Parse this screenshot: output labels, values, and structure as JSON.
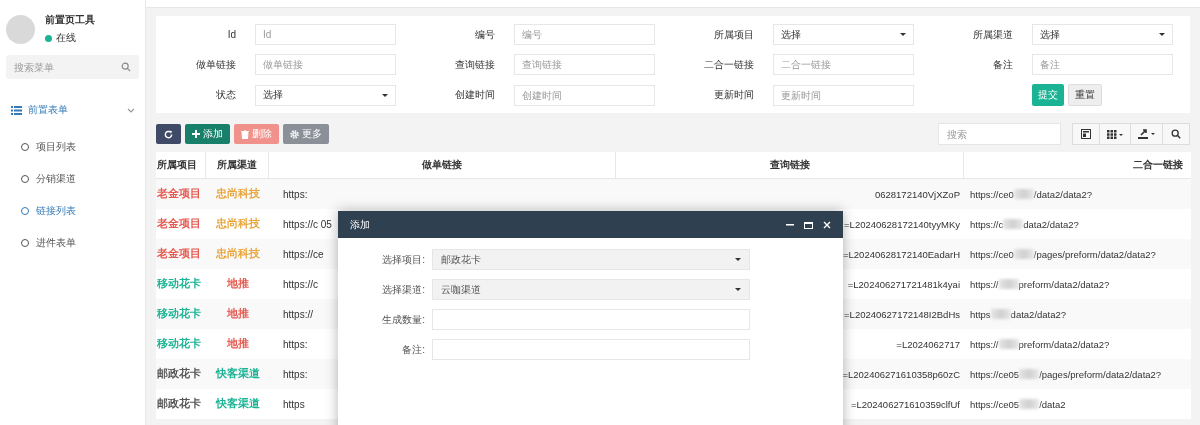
{
  "sidebar": {
    "user": {
      "name": "前置页工具",
      "status": "在线",
      "online": true
    },
    "search": {
      "placeholder": "搜索菜单"
    },
    "menu": {
      "label": "前置表单",
      "expanded": true,
      "children": [
        {
          "label": "项目列表",
          "selected": false
        },
        {
          "label": "分销渠道",
          "selected": false
        },
        {
          "label": "链接列表",
          "selected": true
        },
        {
          "label": "进件表单",
          "selected": false
        }
      ]
    }
  },
  "filter": {
    "fields": [
      {
        "label": "Id",
        "kind": "input",
        "placeholder": "Id"
      },
      {
        "label": "编号",
        "kind": "input",
        "placeholder": "编号"
      },
      {
        "label": "所属项目",
        "kind": "select",
        "value": "选择"
      },
      {
        "label": "所属渠道",
        "kind": "select",
        "value": "选择"
      },
      {
        "label": "做单链接",
        "kind": "input",
        "placeholder": "做单链接"
      },
      {
        "label": "查询链接",
        "kind": "input",
        "placeholder": "查询链接"
      },
      {
        "label": "二合一链接",
        "kind": "input",
        "placeholder": "二合一链接"
      },
      {
        "label": "备注",
        "kind": "input",
        "placeholder": "备注"
      },
      {
        "label": "状态",
        "kind": "select",
        "value": "选择"
      },
      {
        "label": "创建时间",
        "kind": "input",
        "placeholder": "创建时间"
      },
      {
        "label": "更新时间",
        "kind": "input",
        "placeholder": "更新时间"
      }
    ],
    "buttons": [
      "提交",
      "重置"
    ]
  },
  "toolbar": {
    "buttons": [
      {
        "kind": "refresh"
      },
      {
        "kind": "add",
        "label": "添加",
        "disabled": false
      },
      {
        "kind": "delete",
        "label": "删除",
        "disabled": true
      },
      {
        "kind": "more",
        "label": "更多",
        "disabled": false
      }
    ],
    "search": {
      "placeholder": "搜索"
    }
  },
  "table": {
    "columns": [
      "所属项目",
      "所属渠道",
      "做单链接",
      "查询链接",
      "二合一链接"
    ],
    "rows": [
      {
        "project": {
          "text": "老金项目",
          "color": "#e5594f"
        },
        "channel": {
          "text": "忠尚科技",
          "color": "#e8a53a"
        },
        "make_link": "https:",
        "query_link": "0628172140VjXZoP",
        "combined_start": "https://ce0",
        "combined_end": "/data2/data2?"
      },
      {
        "project": {
          "text": "老金项目",
          "color": "#e5594f"
        },
        "channel": {
          "text": "忠尚科技",
          "color": "#e8a53a"
        },
        "make_link": "https://c 05",
        "query_link": "=L20240628172140tyyMKy",
        "combined_start": "https://c",
        "combined_end": "data2/data2?"
      },
      {
        "project": {
          "text": "老金项目",
          "color": "#e5594f"
        },
        "channel": {
          "text": "忠尚科技",
          "color": "#e8a53a"
        },
        "make_link": "https://ce",
        "query_link": "=L20240628172140EadarH",
        "combined_start": "https://ce0",
        "combined_end": "/pages/preform/data2/data2?"
      },
      {
        "project": {
          "text": "移动花卡",
          "color": "#1ab394"
        },
        "channel": {
          "text": "地推",
          "color": "#e5594f"
        },
        "make_link": "https://c",
        "query_link": "=L202406271721481k4yai",
        "combined_start": "https://",
        "combined_end": "preform/data2/data2?"
      },
      {
        "project": {
          "text": "移动花卡",
          "color": "#1ab394"
        },
        "channel": {
          "text": "地推",
          "color": "#e5594f"
        },
        "make_link": "https://",
        "query_link": "=L20240627172148I2BdHs",
        "combined_start": "https",
        "combined_end": "data2/data2?"
      },
      {
        "project": {
          "text": "移动花卡",
          "color": "#1ab394"
        },
        "channel": {
          "text": "地推",
          "color": "#e5594f"
        },
        "make_link": "https:",
        "query_link": "=L2024062717",
        "combined_start": "https://",
        "combined_end": "preform/data2/data2?"
      },
      {
        "project": {
          "text": "邮政花卡",
          "color": "#555555"
        },
        "channel": {
          "text": "快客渠道",
          "color": "#1ab394"
        },
        "make_link": "https:",
        "query_link": "=L202406271610358p60zC",
        "combined_start": "https://ce05",
        "combined_end": "/pages/preform/data2/data2?"
      },
      {
        "project": {
          "text": "邮政花卡",
          "color": "#555555"
        },
        "channel": {
          "text": "快客渠道",
          "color": "#1ab394"
        },
        "make_link": "https",
        "query_link": "=L202406271610359clfUf",
        "combined_start": "https://ce05",
        "combined_end": "/data2"
      }
    ]
  },
  "dialog": {
    "title": "添加",
    "fields": [
      {
        "label": "选择项目:",
        "kind": "select",
        "value": "邮政花卡"
      },
      {
        "label": "选择渠道:",
        "kind": "select",
        "value": "云咖渠道"
      },
      {
        "label": "生成数量:",
        "kind": "input"
      },
      {
        "label": "备注:",
        "kind": "input"
      }
    ]
  }
}
